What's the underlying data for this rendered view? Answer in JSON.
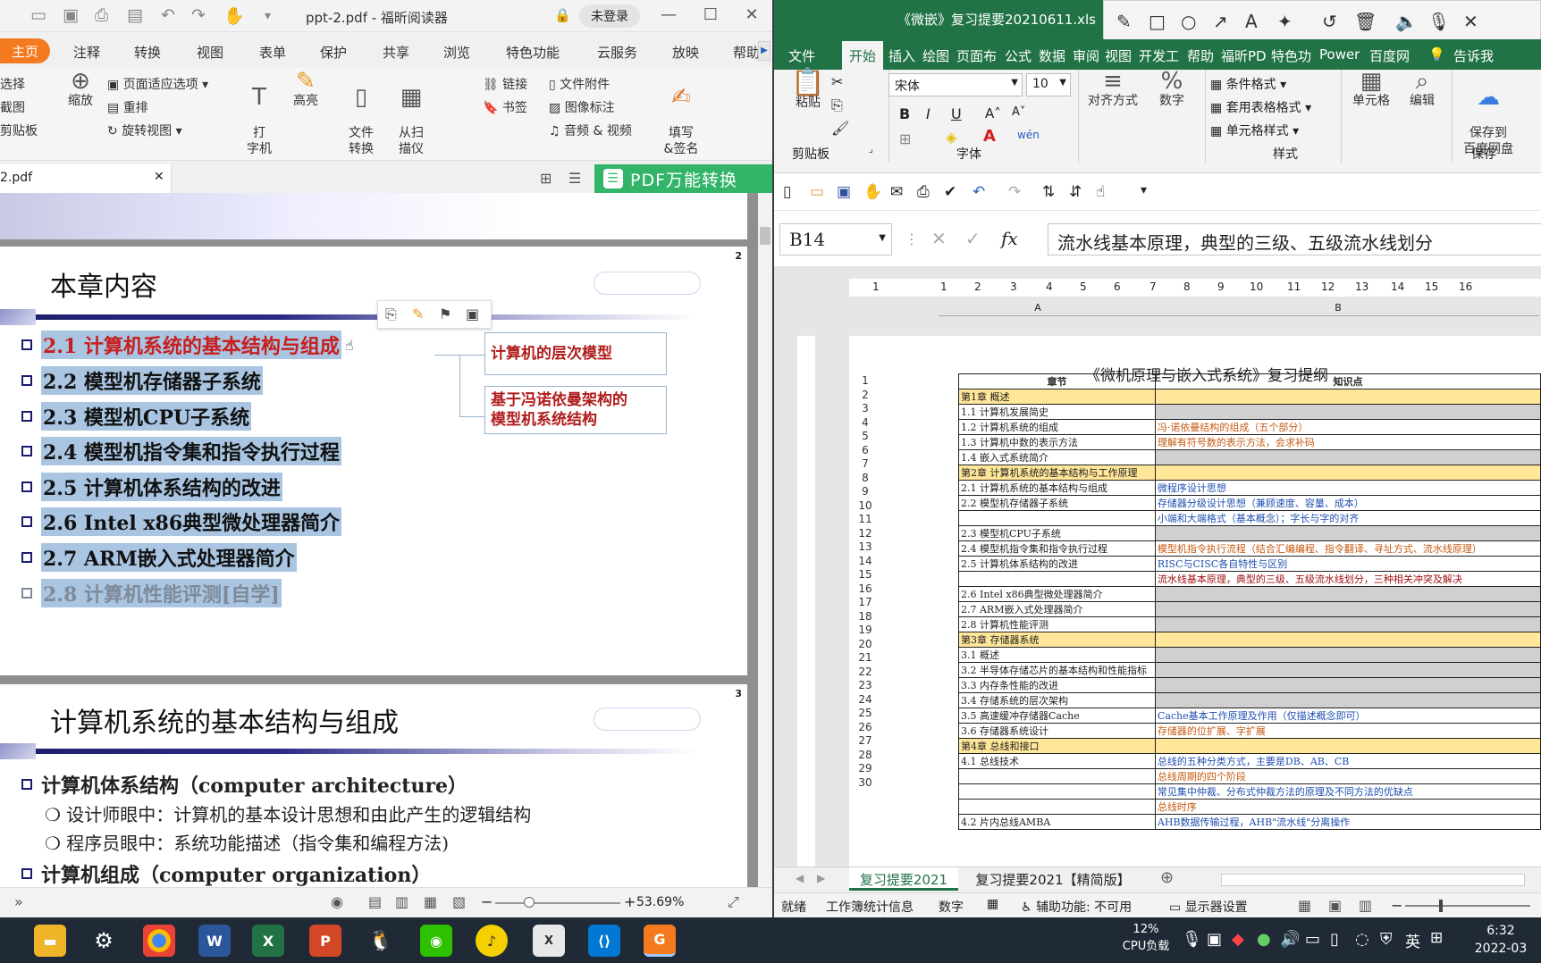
{
  "pdf": {
    "title": "ppt-2.pdf - 福昕阅读器",
    "login": "未登录",
    "menu": [
      "主页",
      "注释",
      "转换",
      "视图",
      "表单",
      "保护",
      "共享",
      "浏览",
      "特色功能",
      "云服务",
      "放映",
      "帮助"
    ],
    "ribbon": {
      "select": "选择",
      "screenshot": "截图",
      "clipboard": "剪贴板",
      "zoom": "缩放",
      "fit_options": "页面适应选项",
      "reflow": "重排",
      "rotate": "旋转视图",
      "typewriter": "打\n字机",
      "highlight": "高亮",
      "file_convert": "文件\n转换",
      "scan": "从扫\n描仪",
      "link": "链接",
      "bookmark": "书签",
      "attachment": "文件附件",
      "image_annot": "图像标注",
      "audio_video": "音频 & 视频",
      "fill_sign": "填写\n&签名"
    },
    "doc_tab": "2.pdf",
    "convert_banner": "PDF万能转换",
    "page2": {
      "number": "2",
      "title": "本章内容",
      "items": [
        "2.1 计算机系统的基本结构与组成",
        "2.2  模型机存储器子系统",
        "2.3  模型机CPU子系统",
        "2.4  模型机指令集和指令执行过程",
        "2.5  计算机体系结构的改进",
        "2.6  Intel x86典型微处理器简介",
        "2.7  ARM嵌入式处理器简介",
        "2.8  计算机性能评测[自学]"
      ],
      "callout1": "计算机的层次模型",
      "callout2": "基于冯诺依曼架构的\n模型机系统结构"
    },
    "page3": {
      "number": "3",
      "title": "计算机系统的基本结构与组成",
      "l1": "计算机体系结构（computer architecture）",
      "l2": "设计师眼中：计算机的基本设计思想和由此产生的逻辑结构",
      "l3": "程序员眼中：系统功能描述（指令集和编程方法)",
      "l4": "计算机组成（computer organization）"
    },
    "zoom": "53.69%"
  },
  "excel": {
    "title": "《微嵌》复习提要20210611.xls",
    "tabs": [
      "文件",
      "开始",
      "插入",
      "绘图",
      "页面布",
      "公式",
      "数据",
      "审阅",
      "视图",
      "开发工",
      "帮助",
      "福昕PD",
      "特色功",
      "Power",
      "百度网",
      "告诉我"
    ],
    "ribbon": {
      "paste": "粘贴",
      "clipboard": "剪贴板",
      "font_name": "宋体",
      "font_size": "10",
      "font": "字体",
      "align": "对齐方式",
      "number": "数字",
      "cond_format": "条件格式",
      "table_format": "套用表格格式",
      "cell_style": "单元格样式",
      "styles": "样式",
      "cells": "单元格",
      "edit": "编辑",
      "save_to": "保存到\n百度网盘",
      "save": "保存"
    },
    "namebox": "B14",
    "formula": "流水线基本原理，典型的三级、五级流水线划分",
    "ruler": [
      "1",
      "1",
      "2",
      "3",
      "4",
      "5",
      "6",
      "7",
      "8",
      "9",
      "10",
      "11",
      "12",
      "13",
      "14",
      "15",
      "16"
    ],
    "col_a": "A",
    "col_b": "B",
    "sheet_title": "《微机原理与嵌入式系统》复习提纲",
    "header": [
      "章节",
      "知识点"
    ],
    "rows": [
      {
        "n": "2",
        "a": "第1章 概述",
        "b": "",
        "t": "chap"
      },
      {
        "n": "3",
        "a": "1.1 计算机发展简史",
        "b": "",
        "t": "gray"
      },
      {
        "n": "4",
        "a": "1.2 计算机系统的组成",
        "b": "冯·诺依曼结构的组成（五个部分）",
        "t": "orange"
      },
      {
        "n": "5",
        "a": "1.3 计算机中数的表示方法",
        "b": "理解有符号数的表示方法，会求补码",
        "t": "orange"
      },
      {
        "n": "6",
        "a": "1.4 嵌入式系统简介",
        "b": "",
        "t": "gray"
      },
      {
        "n": "7",
        "a": "第2章 计算机系统的基本结构与工作原理",
        "b": "",
        "t": "chap"
      },
      {
        "n": "8",
        "a": "2.1 计算机系统的基本结构与组成",
        "b": "微程序设计思想",
        "t": "blue"
      },
      {
        "n": "9",
        "a": "2.2 模型机存储器子系统",
        "b": "存储器分级设计思想（兼顾速度、容量、成本）",
        "t": "blue"
      },
      {
        "n": "10",
        "a": "",
        "b": "小端和大端格式（基本概念）；字长与字的对齐",
        "t": "blue"
      },
      {
        "n": "11",
        "a": "2.3 模型机CPU子系统",
        "b": "",
        "t": "gray"
      },
      {
        "n": "12",
        "a": "2.4 模型机指令集和指令执行过程",
        "b": "模型机指令执行流程（结合汇编编程、指令翻译、寻址方式、流水线原理）",
        "t": "orange"
      },
      {
        "n": "13",
        "a": "2.5 计算机体系结构的改进",
        "b": "RISC与CISC各自特性与区别",
        "t": "blue"
      },
      {
        "n": "14",
        "a": "",
        "b": "流水线基本原理，典型的三级、五级流水线划分，三种相关冲突及解决",
        "t": "dred"
      },
      {
        "n": "15",
        "a": "2.6 Intel x86典型微处理器简介",
        "b": "",
        "t": "gray"
      },
      {
        "n": "16",
        "a": "2.7 ARM嵌入式处理器简介",
        "b": "",
        "t": "gray"
      },
      {
        "n": "17",
        "a": "2.8 计算机性能评测",
        "b": "",
        "t": "gray"
      },
      {
        "n": "18",
        "a": "第3章 存储器系统",
        "b": "",
        "t": "chap"
      },
      {
        "n": "19",
        "a": "3.1 概述",
        "b": "",
        "t": "gray"
      },
      {
        "n": "20",
        "a": "3.2 半导体存储芯片的基本结构和性能指标",
        "b": "",
        "t": "gray"
      },
      {
        "n": "21",
        "a": "3.3 内存条性能的改进",
        "b": "",
        "t": "gray"
      },
      {
        "n": "22",
        "a": "3.4 存储系统的层次架构",
        "b": "",
        "t": "gray"
      },
      {
        "n": "23",
        "a": "3.5 高速缓冲存储器Cache",
        "b": "Cache基本工作原理及作用（仅描述概念即可）",
        "t": "blue"
      },
      {
        "n": "24",
        "a": "3.6 存储器系统设计",
        "b": "存储器的位扩展、字扩展",
        "t": "orange"
      },
      {
        "n": "25",
        "a": "第4章 总线和接口",
        "b": "",
        "t": "chap"
      },
      {
        "n": "26",
        "a": "4.1 总线技术",
        "b": "总线的五种分类方式，主要是DB、AB、CB",
        "t": "blue"
      },
      {
        "n": "27",
        "a": "",
        "b": "总线周期的四个阶段",
        "t": "orange"
      },
      {
        "n": "28",
        "a": "",
        "b": "常见集中仲裁、分布式仲裁方法的原理及不同方法的优缺点",
        "t": "blue"
      },
      {
        "n": "29",
        "a": "",
        "b": "总线时序",
        "t": "orange"
      },
      {
        "n": "30",
        "a": "4.2 片内总线AMBA",
        "b": "AHB数据传输过程，AHB\"流水线\"分离操作",
        "t": "blue"
      }
    ],
    "sheets": [
      "复习提要2021",
      "复习提要2021【精简版】"
    ],
    "status": {
      "ready": "就绪",
      "workbook_stats": "工作簿统计信息",
      "numbers": "数字",
      "accessibility": "辅助功能: 不可用",
      "display_settings": "显示器设置"
    }
  },
  "taskbar": {
    "apps": [
      "explorer",
      "settings",
      "chrome",
      "word",
      "excel",
      "powerpoint",
      "qq",
      "wechat",
      "music",
      "xmind",
      "vscode",
      "foxit"
    ],
    "cpu_pct": "12%",
    "cpu_label": "CPU负载",
    "ime": "英",
    "time": "6:32",
    "date": "2022-03"
  },
  "colors": {
    "foxit_orange": "#f47a20",
    "excel_green": "#217346",
    "convert_green": "#33b569",
    "highlight_blue": "#a9c5e2",
    "chapter_yellow": "#ffe699"
  }
}
